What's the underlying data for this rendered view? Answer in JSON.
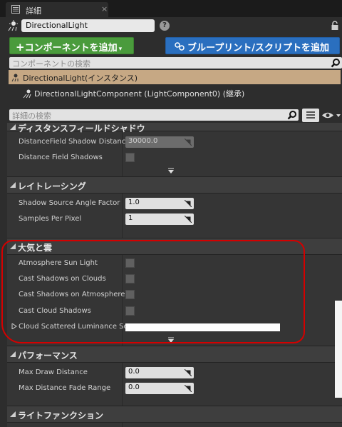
{
  "window": {
    "tab_label": "詳細",
    "close_glyph": "×"
  },
  "actor": {
    "name": "DirectionalLight",
    "help_glyph": "?"
  },
  "buttons": {
    "add_component": "コンポーネントを追加",
    "add_component_plus": "+",
    "add_component_caret": "▾",
    "blueprint": "ブループリント/スクリプトを追加"
  },
  "component_search": {
    "placeholder": "コンポーネントの検索"
  },
  "component_tree": {
    "root": "DirectionalLight(インスタンス)",
    "child": "DirectionalLightComponent (LightComponent0) (継承)"
  },
  "details_search": {
    "placeholder": "詳細の検索"
  },
  "sections": {
    "distance_field": {
      "title": "ディスタンスフィールドシャドウ",
      "props": [
        {
          "label": "DistanceField Shadow Distance",
          "value": "30000.0"
        },
        {
          "label": "Distance Field Shadows"
        }
      ]
    },
    "ray_tracing": {
      "title": "レイトレーシング",
      "props": [
        {
          "label": "Shadow Source Angle Factor",
          "value": "1.0"
        },
        {
          "label": "Samples Per Pixel",
          "value": "1"
        }
      ]
    },
    "atmosphere": {
      "title": "大気と雲",
      "props": [
        {
          "label": "Atmosphere Sun Light"
        },
        {
          "label": "Cast Shadows on Clouds"
        },
        {
          "label": "Cast Shadows on Atmosphere"
        },
        {
          "label": "Cast Cloud Shadows"
        },
        {
          "label": "Cloud Scattered Luminance Sc"
        }
      ]
    },
    "performance": {
      "title": "パフォーマンス",
      "props": [
        {
          "label": "Max Draw Distance",
          "value": "0.0"
        },
        {
          "label": "Max Distance Fade Range",
          "value": "0.0"
        }
      ]
    },
    "light_function": {
      "title": "ライトファンクション"
    }
  },
  "colors": {
    "add_button": "#4a9b3c",
    "blueprint_button": "#2a6fbf",
    "tree_selection": "#c6a884",
    "annotation": "#d40000"
  }
}
